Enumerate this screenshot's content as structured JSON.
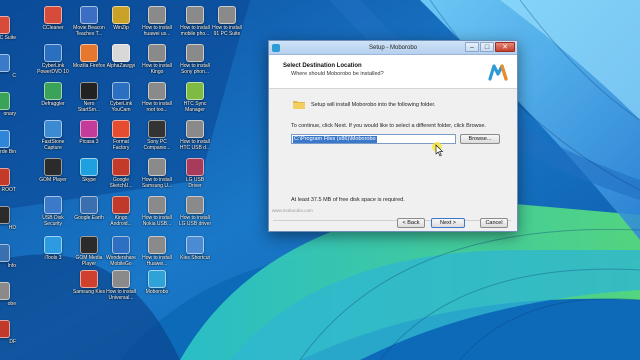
{
  "desktop": {
    "icons": [
      {
        "name": "ccleaner",
        "label": "CCleaner",
        "label2": "",
        "color": "#d64b3a",
        "col": 1,
        "row": 0
      },
      {
        "name": "movie-beacon",
        "label": "Movie Beacon",
        "label2": "Teaches T...",
        "color": "#3c6fc4",
        "col": 2,
        "row": 0
      },
      {
        "name": "winzip",
        "label": "WinZip",
        "label2": "",
        "color": "#c9a227",
        "col": 3,
        "row": 0
      },
      {
        "name": "how-to-install-huawei",
        "label": "How to install",
        "label2": "huawei us...",
        "color": "#8a8a8a",
        "col": 4,
        "row": 0
      },
      {
        "name": "how-to-install-mobile",
        "label": "How to install",
        "label2": "mobile pho...",
        "color": "#8a8a8a",
        "col": 5,
        "row": 0
      },
      {
        "name": "how-to-install-91pc",
        "label": "How to install",
        "label2": "91 PC Suite",
        "color": "#8a8a8a",
        "col": 6,
        "row": 0
      },
      {
        "name": "cyberlink-powerdvd",
        "label": "CyberLink",
        "label2": "PowerDVD 10",
        "color": "#2a6fc0",
        "col": 1,
        "row": 1
      },
      {
        "name": "mozilla-firefox",
        "label": "Mozilla Firefox",
        "label2": "",
        "color": "#e6772e",
        "col": 2,
        "row": 1
      },
      {
        "name": "alphazawgyi",
        "label": "AlphaZawgyi",
        "label2": "",
        "color": "#d8d8d8",
        "col": 3,
        "row": 1
      },
      {
        "name": "how-to-install-kingo",
        "label": "How to install",
        "label2": "Kingo",
        "color": "#8a8a8a",
        "col": 4,
        "row": 1
      },
      {
        "name": "how-to-install-sony",
        "label": "How to install",
        "label2": "Sony phon...",
        "color": "#8a8a8a",
        "col": 5,
        "row": 1
      },
      {
        "name": "defraggler",
        "label": "Defraggler",
        "label2": "",
        "color": "#3aa35a",
        "col": 1,
        "row": 2
      },
      {
        "name": "nero-startsm",
        "label": "Nero",
        "label2": "StartSm...",
        "color": "#222222",
        "col": 2,
        "row": 2
      },
      {
        "name": "cyberlink-youcam",
        "label": "CyberLink",
        "label2": "YouCam",
        "color": "#2a6fc0",
        "col": 3,
        "row": 2
      },
      {
        "name": "how-to-install-root",
        "label": "How to install",
        "label2": "root too...",
        "color": "#8a8a8a",
        "col": 4,
        "row": 2
      },
      {
        "name": "htc-sync-manager",
        "label": "HTC Sync",
        "label2": "Manager",
        "color": "#7dbb42",
        "col": 5,
        "row": 2
      },
      {
        "name": "faststone-capture",
        "label": "FastStone",
        "label2": "Capture",
        "color": "#3c8ad1",
        "col": 1,
        "row": 3
      },
      {
        "name": "picasa-3",
        "label": "Picasa 3",
        "label2": "",
        "color": "#c43c9a",
        "col": 2,
        "row": 3
      },
      {
        "name": "format-factory",
        "label": "Format",
        "label2": "Factory",
        "color": "#e64c2f",
        "col": 3,
        "row": 3
      },
      {
        "name": "sony-pc-companion",
        "label": "Sony PC",
        "label2": "Companio...",
        "color": "#333333",
        "col": 4,
        "row": 3
      },
      {
        "name": "how-to-install-htc",
        "label": "How to install",
        "label2": "HTC USB d...",
        "color": "#8a8a8a",
        "col": 5,
        "row": 3
      },
      {
        "name": "gom-player",
        "label": "GOM Player",
        "label2": "",
        "color": "#2b2b2b",
        "col": 1,
        "row": 4
      },
      {
        "name": "skype",
        "label": "Skype",
        "label2": "",
        "color": "#1fa0e0",
        "col": 2,
        "row": 4
      },
      {
        "name": "google-sketchup",
        "label": "Google",
        "label2": "SketchU...",
        "color": "#c33a2a",
        "col": 3,
        "row": 4
      },
      {
        "name": "how-to-install-samsung",
        "label": "How to install",
        "label2": "Samsung U...",
        "color": "#8a8a8a",
        "col": 4,
        "row": 4
      },
      {
        "name": "lg-usb-driver",
        "label": "LG USB",
        "label2": "Driver",
        "color": "#a83a5c",
        "col": 5,
        "row": 4
      },
      {
        "name": "usb-disk-security",
        "label": "USB Disk",
        "label2": "Security",
        "color": "#3a7ac9",
        "col": 1,
        "row": 5
      },
      {
        "name": "google-earth",
        "label": "Google Earth",
        "label2": "",
        "color": "#3a6fb0",
        "col": 2,
        "row": 5
      },
      {
        "name": "kingo-android",
        "label": "Kingo",
        "label2": "Android...",
        "color": "#c0392b",
        "col": 3,
        "row": 5
      },
      {
        "name": "how-to-install-nokia",
        "label": "How to install",
        "label2": "Nokia USB...",
        "color": "#8a8a8a",
        "col": 4,
        "row": 5
      },
      {
        "name": "how-to-install-lg",
        "label": "How to install",
        "label2": "LG USB driver",
        "color": "#8a8a8a",
        "col": 5,
        "row": 5
      },
      {
        "name": "itools-3",
        "label": "iTools 3",
        "label2": "",
        "color": "#2c9be2",
        "col": 1,
        "row": 6
      },
      {
        "name": "gom-media-player",
        "label": "GOM Media",
        "label2": "Player",
        "color": "#2b2b2b",
        "col": 2,
        "row": 6
      },
      {
        "name": "wondershare",
        "label": "Wondershare",
        "label2": "MobileGo",
        "color": "#2f6fc1",
        "col": 3,
        "row": 6
      },
      {
        "name": "how-to-install-huawei-2",
        "label": "How to install",
        "label2": "Huawei...",
        "color": "#8a8a8a",
        "col": 4,
        "row": 6
      },
      {
        "name": "kies-shortcut",
        "label": "Kies Shortcut",
        "label2": "",
        "color": "#4a8bd3",
        "col": 5,
        "row": 6
      },
      {
        "name": "samsung-kies",
        "label": "Samsung Kies",
        "label2": "",
        "color": "#d0402f",
        "col": 2,
        "row": 7
      },
      {
        "name": "how-to-install-universal",
        "label": "How to install",
        "label2": "Universal...",
        "color": "#8a8a8a",
        "col": 3,
        "row": 7
      },
      {
        "name": "moborobo",
        "label": "Moborobo",
        "label2": "",
        "color": "#2fa3d8",
        "col": 4,
        "row": 7
      }
    ],
    "edge_labels": [
      "PC Suite",
      "C",
      "onary",
      "rde Bin",
      "ROOT",
      "HD",
      "Info",
      "obe",
      "DF"
    ]
  },
  "dialog": {
    "title": "Setup - Moborobo",
    "header_title": "Select Destination Location",
    "header_subtitle": "Where should Moborobo be installed?",
    "intro_text": "Setup will install Moborobo into the following folder.",
    "instruction_text": "To continue, click Next. If you would like to select a different folder, click Browse.",
    "path_value": "C:\\Program Files (x86)\\Moborobo",
    "browse_label": "Browse...",
    "space_text": "At least 37.5 MB of free disk space is required.",
    "brand_text": "www.moborobo.com",
    "back_label": "< Back",
    "next_label": "Next >",
    "cancel_label": "Cancel",
    "accent_color": "#2f9bd6"
  }
}
